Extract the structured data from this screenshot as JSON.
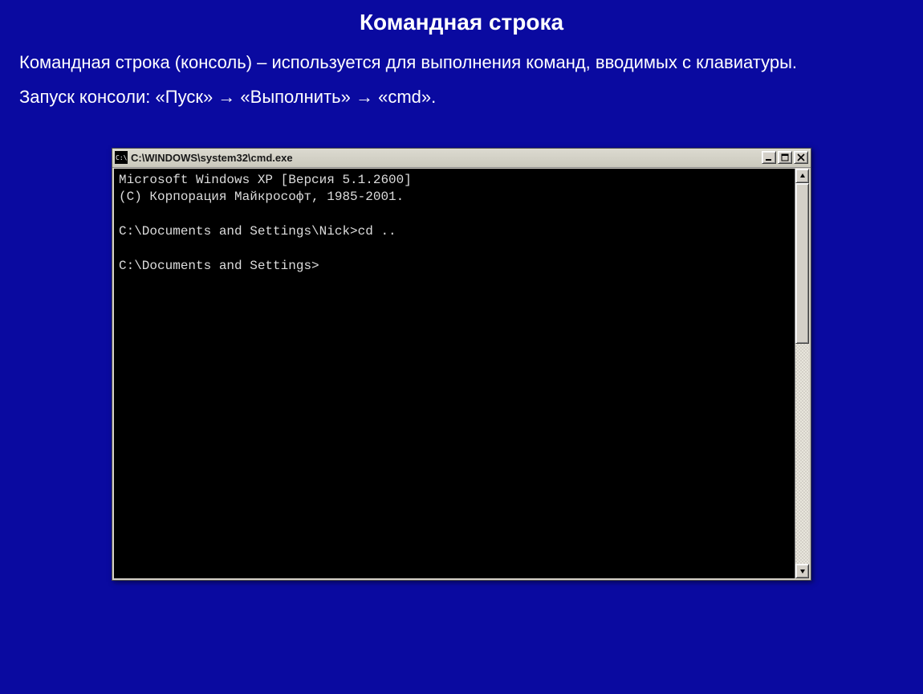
{
  "slide": {
    "title": "Командная строка",
    "description": "Командная строка (консоль) – используется для выполнения команд, вводимых с клавиатуры.",
    "launch": "Запуск консоли: «Пуск» → «Выполнить» → «cmd»."
  },
  "window": {
    "title": "C:\\WINDOWS\\system32\\cmd.exe"
  },
  "console": {
    "lines": [
      "Microsoft Windows XP [Версия 5.1.2600]",
      "(C) Корпорация Майкрософт, 1985-2001.",
      "",
      "C:\\Documents and Settings\\Nick>cd ..",
      "",
      "C:\\Documents and Settings>"
    ]
  }
}
